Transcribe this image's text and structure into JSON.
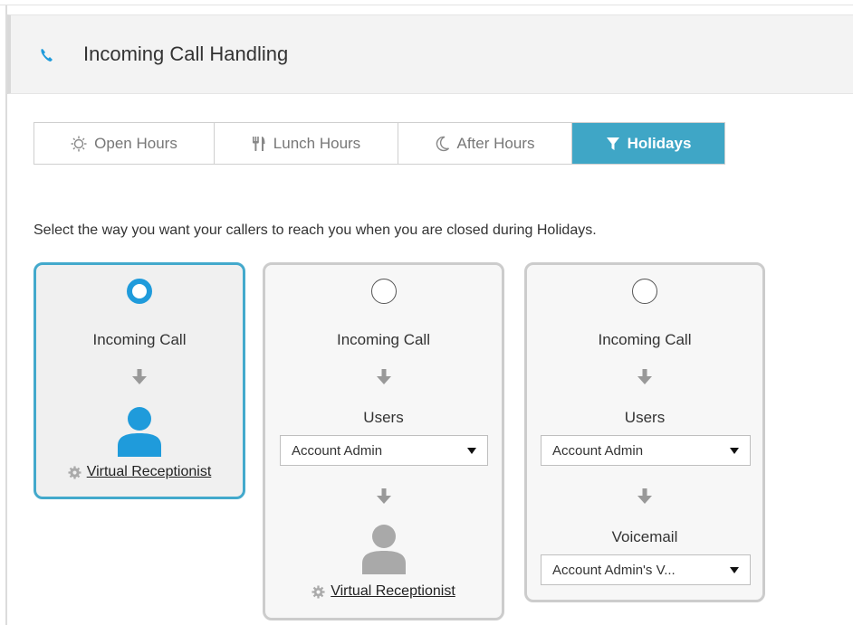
{
  "header": {
    "title": "Incoming Call Handling",
    "icon": "phone-icon"
  },
  "tabs": [
    {
      "label": "Open Hours",
      "icon": "sun-icon",
      "active": false
    },
    {
      "label": "Lunch Hours",
      "icon": "utensils-icon",
      "active": false
    },
    {
      "label": "After Hours",
      "icon": "moon-icon",
      "active": false
    },
    {
      "label": "Holidays",
      "icon": "filter-icon",
      "active": true
    }
  ],
  "instruction": "Select the way you want your callers to reach you when you are closed during Holidays.",
  "options": [
    {
      "selected": true,
      "incoming_label": "Incoming Call",
      "destination_link": "Virtual Receptionist"
    },
    {
      "selected": false,
      "incoming_label": "Incoming Call",
      "users_label": "Users",
      "users_select": "Account Admin",
      "destination_link": "Virtual Receptionist"
    },
    {
      "selected": false,
      "incoming_label": "Incoming Call",
      "users_label": "Users",
      "users_select": "Account Admin",
      "voicemail_label": "Voicemail",
      "voicemail_select": "Account Admin's V..."
    }
  ],
  "colors": {
    "accent": "#3fa6c6",
    "radio_selected": "#1f9bdb",
    "person_active": "#1f9bdb",
    "person_inactive": "#a9a9a9"
  }
}
